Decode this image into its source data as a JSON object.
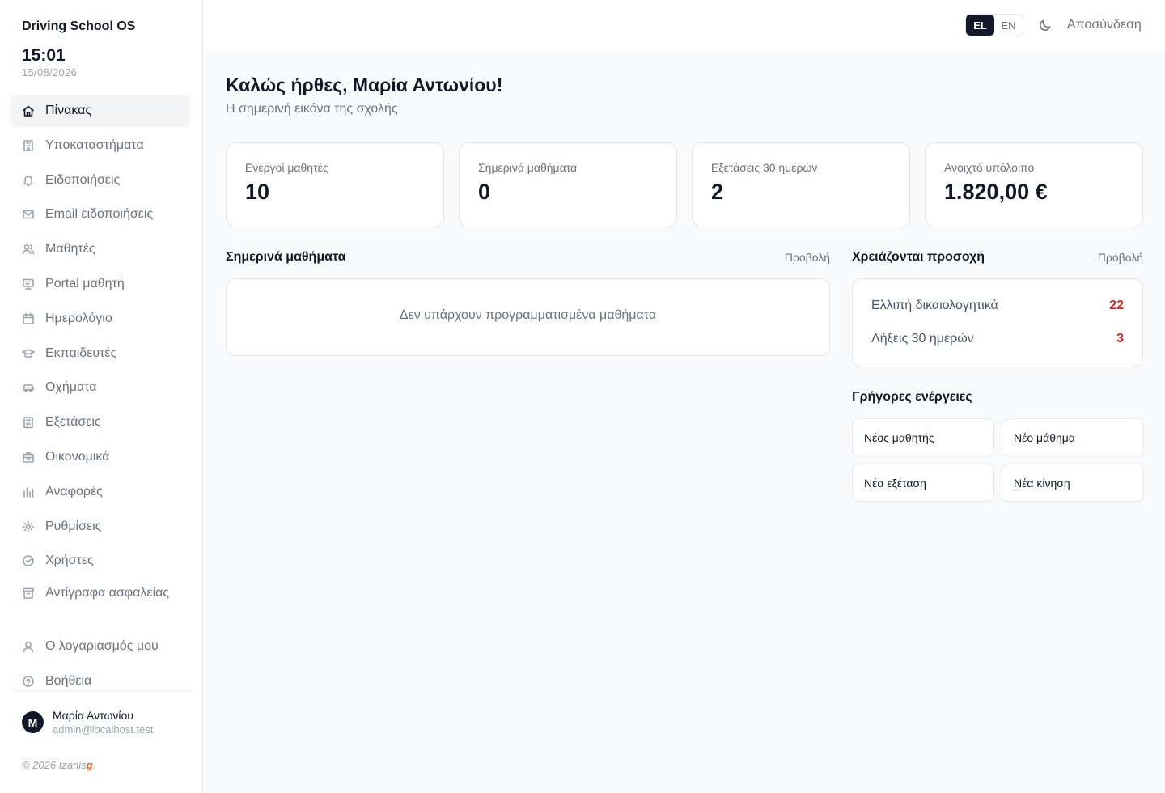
{
  "app": {
    "name": "Driving School OS",
    "time": "15:01",
    "date": "15/08/2026"
  },
  "nav": [
    {
      "label": "Πίνακας",
      "icon": "home-icon",
      "active": true
    },
    {
      "label": "Υποκαταστήματα",
      "icon": "building-icon"
    },
    {
      "label": "Ειδοποιήσεις",
      "icon": "bell-icon"
    },
    {
      "label": "Email ειδοποιήσεις",
      "icon": "mail-icon"
    },
    {
      "label": "Μαθητές",
      "icon": "users-icon"
    },
    {
      "label": "Portal μαθητή",
      "icon": "monitor-icon"
    },
    {
      "label": "Ημερολόγιο",
      "icon": "calendar-icon"
    },
    {
      "label": "Εκπαιδευτές",
      "icon": "graduation-cap-icon"
    },
    {
      "label": "Οχήματα",
      "icon": "car-icon"
    },
    {
      "label": "Εξετάσεις",
      "icon": "clipboard-icon"
    },
    {
      "label": "Οικονομικά",
      "icon": "briefcase-icon"
    },
    {
      "label": "Αναφορές",
      "icon": "bar-chart-icon"
    },
    {
      "label": "Ρυθμίσεις",
      "icon": "gear-icon"
    },
    {
      "label": "Χρήστες",
      "icon": "check-circle-icon"
    },
    {
      "label": "Αντίγραφα ασφαλείας",
      "icon": "archive-icon"
    },
    {
      "label": "Ο λογαριασμός μου",
      "icon": "user-icon"
    },
    {
      "label": "Βοήθεια",
      "icon": "help-icon"
    }
  ],
  "user": {
    "initial": "M",
    "name": "Μαρία Αντωνίου",
    "email": "admin@localhost.test"
  },
  "footer": {
    "text": "© 2026 tzanis",
    "accent": "g",
    "end": "."
  },
  "topbar": {
    "lang_el": "EL",
    "lang_en": "EN",
    "logout": "Αποσύνδεση"
  },
  "main": {
    "greeting": "Καλώς ήρθες, Μαρία Αντωνίου!",
    "subtitle": "Η σημερινή εικόνα της σχολής",
    "stats": [
      {
        "label": "Ενεργοί μαθητές",
        "value": "10"
      },
      {
        "label": "Σημερινά μαθήματα",
        "value": "0"
      },
      {
        "label": "Εξετάσεις 30 ημερών",
        "value": "2"
      },
      {
        "label": "Ανοιχτό υπόλοιπο",
        "value": "1.820,00 €"
      }
    ],
    "lessons": {
      "title": "Σημερινά μαθήματα",
      "link": "Προβολή",
      "empty": "Δεν υπάρχουν προγραμματισμένα μαθήματα"
    },
    "attention": {
      "title": "Χρειάζονται προσοχή",
      "link": "Προβολή",
      "items": [
        {
          "label": "Ελλιπή δικαιολογητικά",
          "count": "22"
        },
        {
          "label": "Λήξεις 30 ημερών",
          "count": "3"
        }
      ]
    },
    "quick_actions": {
      "title": "Γρήγορες ενέργειες",
      "items": [
        "Νέος μαθητής",
        "Νέο μάθημα",
        "Νέα εξέταση",
        "Νέα κίνηση"
      ]
    }
  },
  "colors": {
    "accent": "#111827",
    "alert": "#dc2626",
    "brand_accent": "#ea580c"
  }
}
